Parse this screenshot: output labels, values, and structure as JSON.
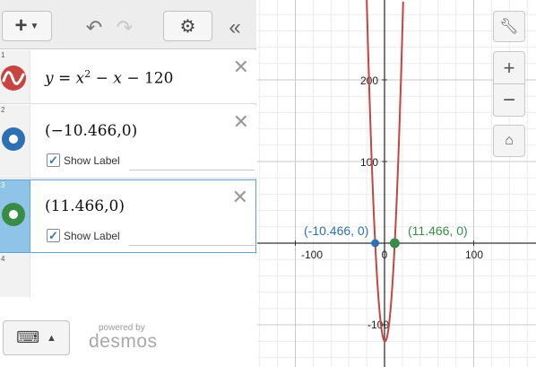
{
  "toolbar": {
    "add_label": "+",
    "undo_icon": "undo-icon",
    "redo_icon": "redo-icon",
    "settings_icon": "gear-icon",
    "collapse_label": "«"
  },
  "expressions": [
    {
      "number": "1",
      "latex_parts": {
        "y": "y",
        "eq": " = ",
        "x": "x",
        "exp": "2",
        "rest": " − ",
        "x2": "x",
        "tail": " − 120"
      },
      "color": "#c74440",
      "icon": "graph-curve-icon"
    },
    {
      "number": "2",
      "text": "(−10.466,0)",
      "color": "#2d70b3",
      "show_label": "Show Label",
      "show_label_checked": true
    },
    {
      "number": "3",
      "text": "(11.466,0)",
      "color": "#388c46",
      "show_label": "Show Label",
      "show_label_checked": true,
      "active": true
    },
    {
      "number": "4"
    }
  ],
  "footer": {
    "keyboard_icon": "keyboard-icon",
    "powered_by": "powered by",
    "brand": "desmos"
  },
  "graph": {
    "x_ticks": [
      "-100",
      "0",
      "100"
    ],
    "y_ticks": [
      "200",
      "100",
      "-100"
    ],
    "point_labels": [
      {
        "text": "(-10.466, 0)",
        "color": "#2d70b3"
      },
      {
        "text": "(11.466, 0)",
        "color": "#388c46"
      }
    ],
    "curve_color": "#c74440",
    "function": "y = x^2 - x - 120",
    "x_range": [
      -157,
      175
    ],
    "y_range": [
      -123,
      298
    ]
  },
  "controls": {
    "settings_icon": "wrench-icon",
    "zoom_in": "+",
    "zoom_out": "−",
    "home_icon": "home-icon"
  }
}
